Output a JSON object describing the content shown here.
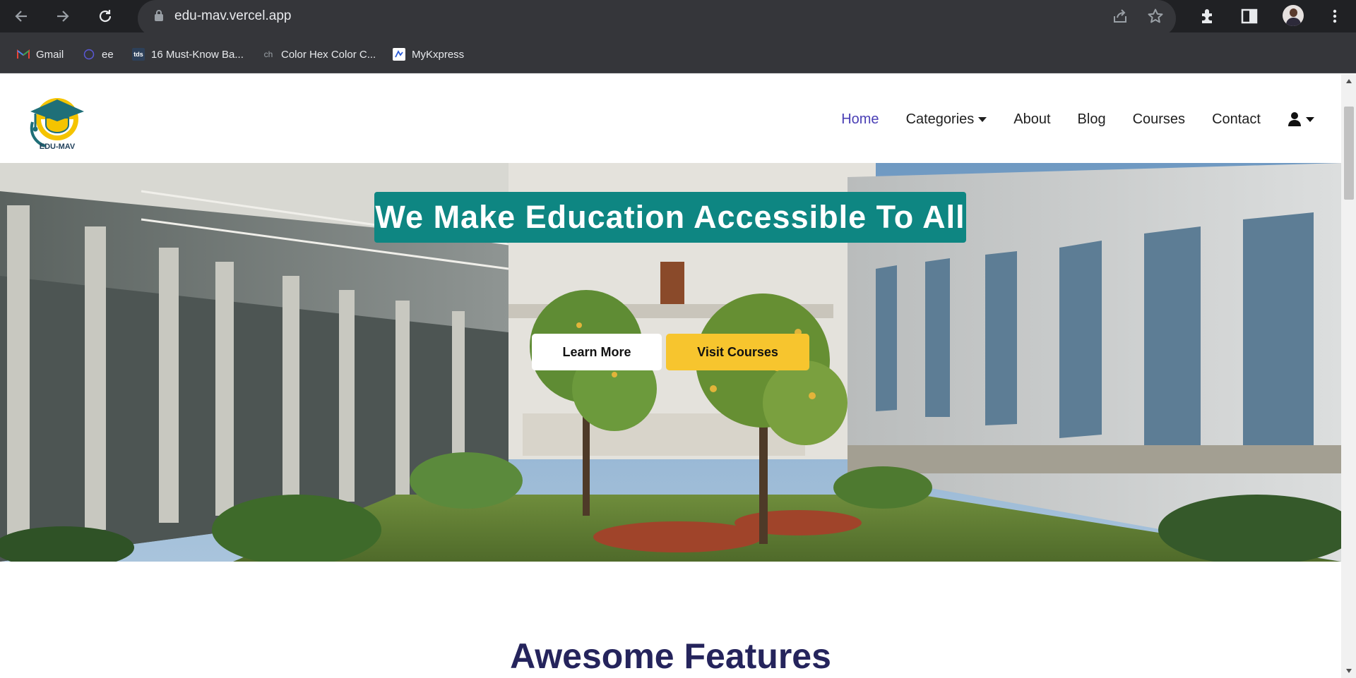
{
  "browser": {
    "url": "edu-mav.vercel.app",
    "bookmarks": [
      {
        "label": "Gmail",
        "icon": "gmail-icon"
      },
      {
        "label": "ee",
        "icon": "circle-icon"
      },
      {
        "label": "16 Must-Know Ba...",
        "icon": "tds-icon",
        "icon_text": "tds"
      },
      {
        "label": "Color Hex Color C...",
        "icon": "ch-icon",
        "icon_text": "ch"
      },
      {
        "label": "MyKxpress",
        "icon": "mykxpress-icon"
      }
    ]
  },
  "site": {
    "logo_text": "EDU-MAV",
    "nav": {
      "items": [
        "Home",
        "Categories",
        "About",
        "Blog",
        "Courses",
        "Contact"
      ],
      "active": "Home",
      "user_icon": "user-icon"
    },
    "hero": {
      "headline": "We Make Education Accessible To All",
      "learn_more": "Learn More",
      "visit_courses": "Visit Courses"
    },
    "features": {
      "title": "Awesome Features"
    }
  },
  "colors": {
    "headline_bg": "#0e8682",
    "visit_bg": "#f7c52e",
    "active_nav": "#4a3fb5",
    "features_title": "#25245c"
  }
}
